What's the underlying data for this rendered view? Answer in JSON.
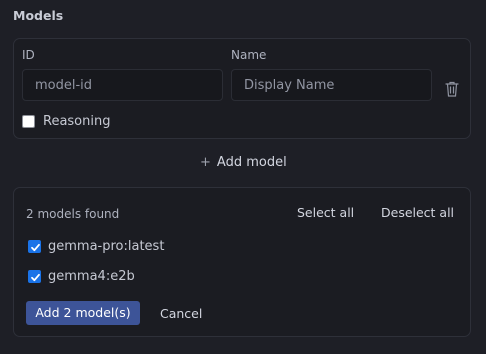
{
  "section": {
    "title": "Models"
  },
  "model_form": {
    "id_label": "ID",
    "name_label": "Name",
    "id_field": {
      "value": "",
      "placeholder": "model-id"
    },
    "name_field": {
      "value": "",
      "placeholder": "Display Name"
    },
    "reasoning": {
      "label": "Reasoning",
      "checked": false
    }
  },
  "add_model": {
    "icon": "+",
    "label": "Add model"
  },
  "discovery": {
    "found_text": "2 models found",
    "select_all": "Select all",
    "deselect_all": "Deselect all",
    "models": [
      {
        "name": "gemma-pro:latest",
        "checked": true
      },
      {
        "name": "gemma4:e2b",
        "checked": true
      }
    ],
    "add_button": "Add 2 model(s)",
    "cancel_button": "Cancel"
  },
  "colors": {
    "background": "#1e1f26",
    "card": "#1b1c22",
    "checkbox_checked": "#1a73e8",
    "primary_button": "#3d5498"
  }
}
